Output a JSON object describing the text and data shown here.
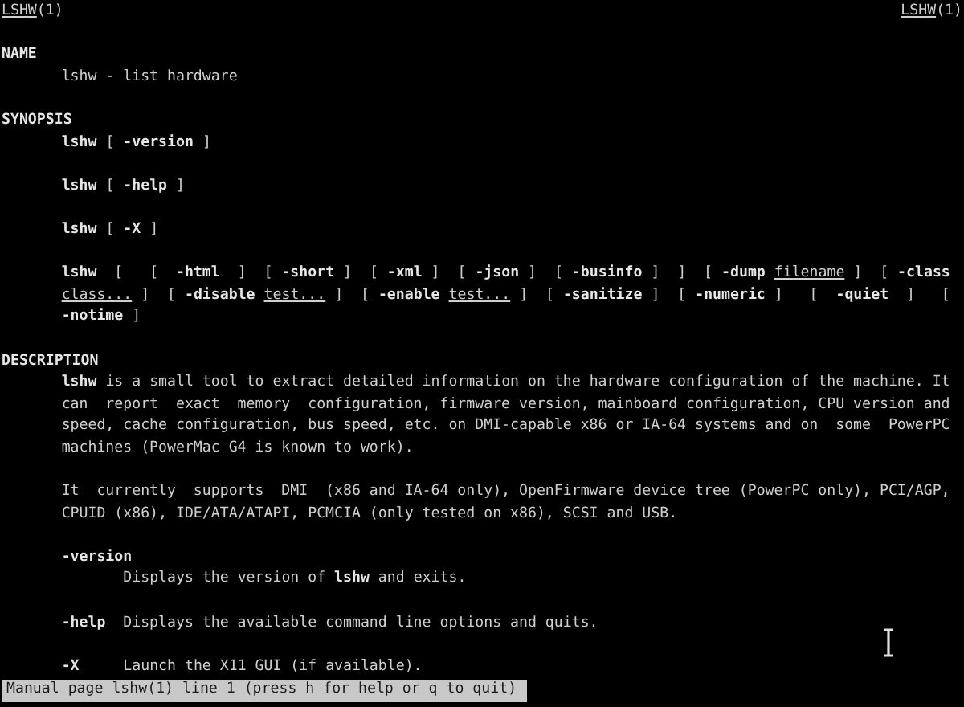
{
  "header": {
    "left": [
      {
        "text": "LSHW",
        "kind": "underline"
      },
      {
        "text": "(1)",
        "kind": "plain"
      }
    ],
    "right": [
      {
        "text": "LSHW",
        "kind": "underline"
      },
      {
        "text": "(1)",
        "kind": "plain"
      }
    ]
  },
  "lines": [
    {
      "kind": "blank"
    },
    {
      "kind": "heading",
      "segments": [
        {
          "text": "NAME",
          "kind": "bold"
        }
      ]
    },
    {
      "kind": "body",
      "segments": [
        {
          "text": "lshw - list hardware",
          "kind": "plain"
        }
      ]
    },
    {
      "kind": "blank"
    },
    {
      "kind": "heading",
      "segments": [
        {
          "text": "SYNOPSIS",
          "kind": "bold"
        }
      ]
    },
    {
      "kind": "body",
      "segments": [
        {
          "text": "lshw",
          "kind": "bold"
        },
        {
          "text": " [ ",
          "kind": "plain"
        },
        {
          "text": "-version",
          "kind": "bold"
        },
        {
          "text": " ]",
          "kind": "plain"
        }
      ]
    },
    {
      "kind": "blank"
    },
    {
      "kind": "body",
      "segments": [
        {
          "text": "lshw",
          "kind": "bold"
        },
        {
          "text": " [ ",
          "kind": "plain"
        },
        {
          "text": "-help",
          "kind": "bold"
        },
        {
          "text": " ]",
          "kind": "plain"
        }
      ]
    },
    {
      "kind": "blank"
    },
    {
      "kind": "body",
      "segments": [
        {
          "text": "lshw",
          "kind": "bold"
        },
        {
          "text": " [ ",
          "kind": "plain"
        },
        {
          "text": "-X",
          "kind": "bold"
        },
        {
          "text": " ]",
          "kind": "plain"
        }
      ]
    },
    {
      "kind": "blank"
    },
    {
      "kind": "body",
      "segments": [
        {
          "text": "lshw",
          "kind": "bold"
        },
        {
          "text": "  [   [  ",
          "kind": "plain"
        },
        {
          "text": "-html",
          "kind": "bold"
        },
        {
          "text": "  ]  [ ",
          "kind": "plain"
        },
        {
          "text": "-short",
          "kind": "bold"
        },
        {
          "text": " ]  [ ",
          "kind": "plain"
        },
        {
          "text": "-xml",
          "kind": "bold"
        },
        {
          "text": " ]  [ ",
          "kind": "plain"
        },
        {
          "text": "-json",
          "kind": "bold"
        },
        {
          "text": " ]  [ ",
          "kind": "plain"
        },
        {
          "text": "-businfo",
          "kind": "bold"
        },
        {
          "text": " ]  ]  [ ",
          "kind": "plain"
        },
        {
          "text": "-dump ",
          "kind": "bold"
        },
        {
          "text": "filename",
          "kind": "underline"
        },
        {
          "text": " ]  [ ",
          "kind": "plain"
        },
        {
          "text": "-class",
          "kind": "bold"
        }
      ]
    },
    {
      "kind": "body",
      "segments": [
        {
          "text": "class...",
          "kind": "underline"
        },
        {
          "text": " ]  [ ",
          "kind": "plain"
        },
        {
          "text": "-disable ",
          "kind": "bold"
        },
        {
          "text": "test...",
          "kind": "underline"
        },
        {
          "text": " ]  [ ",
          "kind": "plain"
        },
        {
          "text": "-enable ",
          "kind": "bold"
        },
        {
          "text": "test...",
          "kind": "underline"
        },
        {
          "text": " ]  [ ",
          "kind": "plain"
        },
        {
          "text": "-sanitize",
          "kind": "bold"
        },
        {
          "text": " ]  [ ",
          "kind": "plain"
        },
        {
          "text": "-numeric",
          "kind": "bold"
        },
        {
          "text": " ]   [  ",
          "kind": "plain"
        },
        {
          "text": "-quiet",
          "kind": "bold"
        },
        {
          "text": "  ]   [",
          "kind": "plain"
        }
      ]
    },
    {
      "kind": "body",
      "segments": [
        {
          "text": "-notime",
          "kind": "bold"
        },
        {
          "text": " ]",
          "kind": "plain"
        }
      ]
    },
    {
      "kind": "blank"
    },
    {
      "kind": "heading",
      "segments": [
        {
          "text": "DESCRIPTION",
          "kind": "bold"
        }
      ]
    },
    {
      "kind": "body",
      "segments": [
        {
          "text": "lshw",
          "kind": "bold"
        },
        {
          "text": " is a small tool to extract detailed information on the hardware configuration of the machine. It",
          "kind": "plain"
        }
      ]
    },
    {
      "kind": "body",
      "segments": [
        {
          "text": "can  report  exact  memory  configuration, firmware version, mainboard configuration, CPU version and",
          "kind": "plain"
        }
      ]
    },
    {
      "kind": "body",
      "segments": [
        {
          "text": "speed, cache configuration, bus speed, etc. on DMI-capable x86 or IA-64 systems and on  some  PowerPC",
          "kind": "plain"
        }
      ]
    },
    {
      "kind": "body",
      "segments": [
        {
          "text": "machines (PowerMac G4 is known to work).",
          "kind": "plain"
        }
      ]
    },
    {
      "kind": "blank"
    },
    {
      "kind": "body",
      "segments": [
        {
          "text": "It  currently  supports  DMI  (x86 and IA-64 only), OpenFirmware device tree (PowerPC only), PCI/AGP,",
          "kind": "plain"
        }
      ]
    },
    {
      "kind": "body",
      "segments": [
        {
          "text": "CPUID (x86), IDE/ATA/ATAPI, PCMCIA (only tested on x86), SCSI and USB.",
          "kind": "plain"
        }
      ]
    },
    {
      "kind": "blank"
    },
    {
      "kind": "body",
      "segments": [
        {
          "text": "-version",
          "kind": "bold"
        }
      ]
    },
    {
      "kind": "detail",
      "segments": [
        {
          "text": "Displays the version of ",
          "kind": "plain"
        },
        {
          "text": "lshw",
          "kind": "bold"
        },
        {
          "text": " and exits.",
          "kind": "plain"
        }
      ]
    },
    {
      "kind": "blank"
    },
    {
      "kind": "body",
      "segments": [
        {
          "text": "-help",
          "kind": "bold"
        },
        {
          "text": "  Displays the available command line options and quits.",
          "kind": "plain"
        }
      ]
    },
    {
      "kind": "blank"
    },
    {
      "kind": "body",
      "segments": [
        {
          "text": "-X",
          "kind": "bold"
        },
        {
          "text": "     Launch the X11 GUI (if available).",
          "kind": "plain"
        }
      ]
    }
  ],
  "status_bar": "Manual page lshw(1) line 1 (press h for help or q to quit)"
}
